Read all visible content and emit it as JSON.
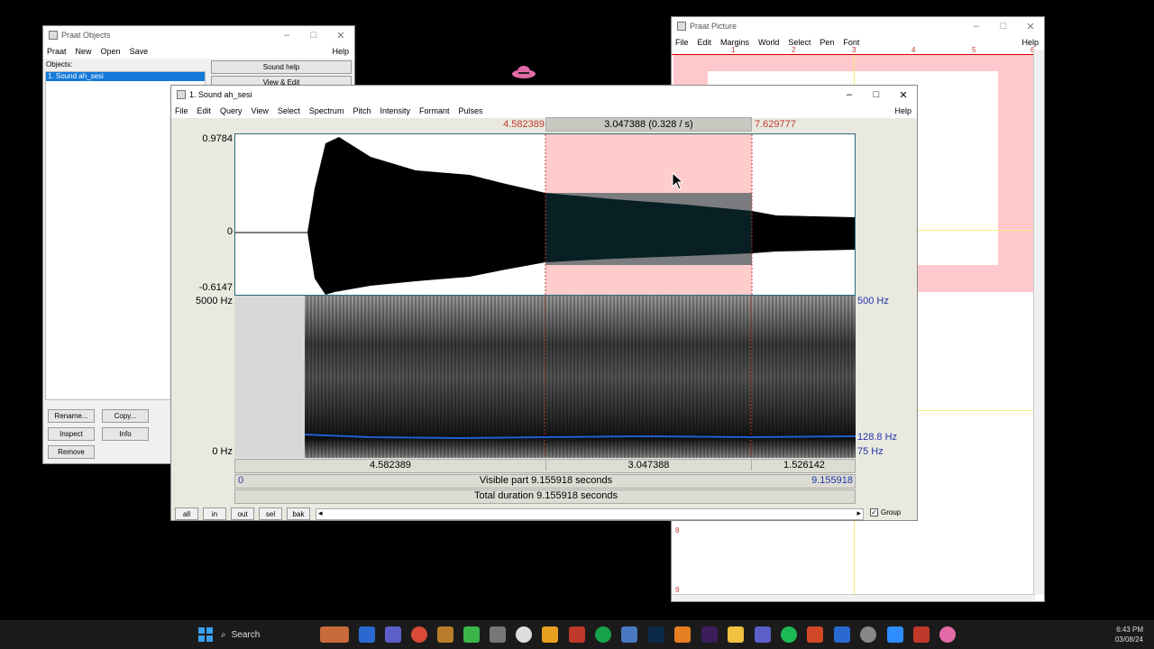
{
  "objects_window": {
    "title": "Praat Objects",
    "menu": [
      "Praat",
      "New",
      "Open",
      "Save"
    ],
    "help": "Help",
    "objects_label": "Objects:",
    "selected_object": "1. Sound ah_sesi",
    "buttons": {
      "sound_help": "Sound help",
      "view_edit": "View & Edit",
      "rename": "Rename...",
      "copy": "Copy...",
      "inspect": "Inspect",
      "info": "Info",
      "remove": "Remove"
    }
  },
  "picture_window": {
    "title": "Praat Picture",
    "menu": [
      "File",
      "Edit",
      "Margins",
      "World",
      "Select",
      "Pen",
      "Font"
    ],
    "help": "Help",
    "ruler": [
      "1",
      "2",
      "3",
      "4",
      "5",
      "6"
    ],
    "side_marks": [
      "8",
      "9"
    ]
  },
  "sound_window": {
    "title": "1. Sound ah_sesi",
    "menu": [
      "File",
      "Edit",
      "Query",
      "View",
      "Select",
      "Spectrum",
      "Pitch",
      "Intensity",
      "Formant",
      "Pulses"
    ],
    "help": "Help",
    "sel_start": "4.582389",
    "sel_duration": "3.047388 (0.328 / s)",
    "sel_end": "7.629777",
    "wave_max": "0.9784",
    "wave_zero": "0",
    "wave_min": "-0.6147",
    "spec_top": "5000 Hz",
    "spec_bottom": "0 Hz",
    "pitch_top": "500 Hz",
    "pitch_value": "128.8 Hz",
    "pitch_bottom": "75 Hz",
    "seg_left": "4.582389",
    "seg_mid": "3.047388",
    "seg_right": "1.526142",
    "visible_start": "0",
    "visible_label": "Visible part 9.155918 seconds",
    "visible_end": "9.155918",
    "total_label": "Total duration 9.155918 seconds",
    "nav_buttons": [
      "all",
      "in",
      "out",
      "sel",
      "bak"
    ],
    "group_label": "Group",
    "group_checked": true
  },
  "taskbar": {
    "search_label": "Search",
    "time": "6:43 PM",
    "date": "03/08/24"
  },
  "colors": {
    "selection": "#ffcccc",
    "pitch": "#1f5fd0",
    "accent_blue": "#1479d9",
    "red_text": "#c0392b"
  }
}
